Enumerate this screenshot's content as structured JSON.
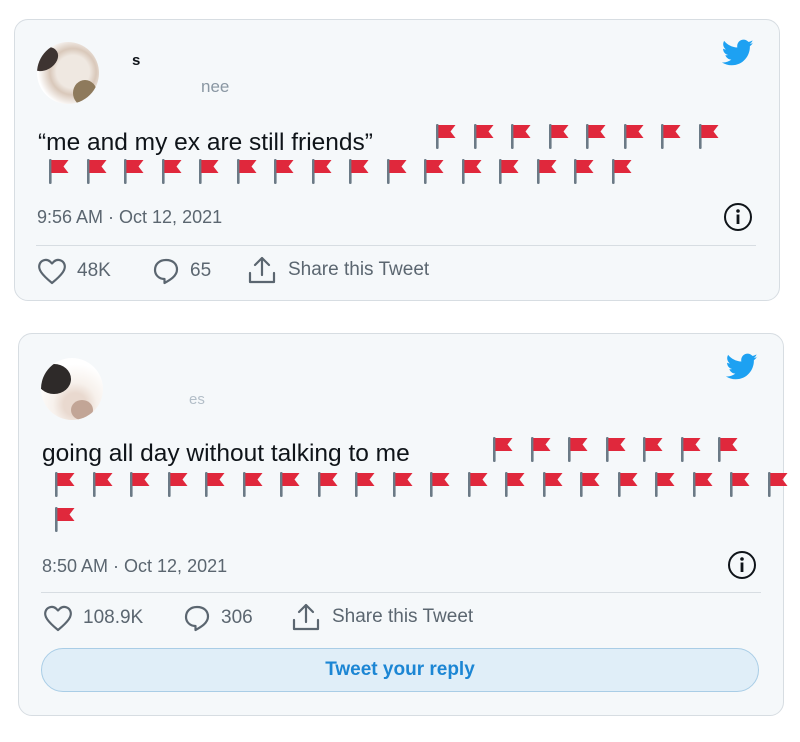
{
  "colors": {
    "twitter_blue": "#1da1f2",
    "flag_red": "#e0283c",
    "text_secondary": "#5b6670"
  },
  "tweets": [
    {
      "name": "s",
      "handle": "nee",
      "text": "“me and my ex are still friends”",
      "flag_count": 24,
      "timestamp": "9:56 AM · Oct 12, 2021",
      "likes": "48K",
      "replies": "65",
      "share_label": "Share this Tweet",
      "icons": [
        "twitter-bird-icon",
        "info-icon",
        "heart-icon",
        "reply-bubble-icon",
        "share-icon",
        "red-flag-icon"
      ]
    },
    {
      "name": "",
      "handle": "es",
      "text": "going all day without talking to me",
      "flag_count": 28,
      "timestamp": "8:50 AM · Oct 12, 2021",
      "likes": "108.9K",
      "replies": "306",
      "share_label": "Share this Tweet",
      "reply_button": "Tweet your reply",
      "icons": [
        "twitter-bird-icon",
        "info-icon",
        "heart-icon",
        "reply-bubble-icon",
        "share-icon",
        "red-flag-icon"
      ]
    }
  ]
}
